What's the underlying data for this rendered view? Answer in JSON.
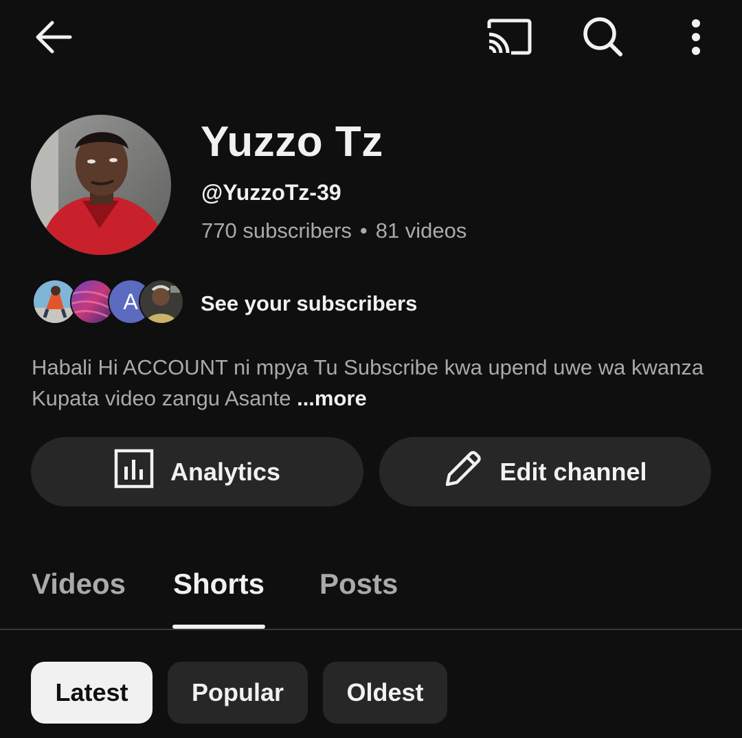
{
  "topbar": {
    "back_icon": "arrow-left-icon",
    "cast_icon": "cast-icon",
    "search_icon": "search-icon",
    "more_icon": "more-vertical-icon"
  },
  "channel": {
    "name": "Yuzzo Tz",
    "handle": "@YuzzoTz-39",
    "subscribers": "770 subscribers",
    "separator": "•",
    "videos": "81 videos"
  },
  "subscribers_row": {
    "label": "See your subscribers",
    "avatar_letter": "A"
  },
  "description": {
    "text": "Habali Hi ACCOUNT ni mpya Tu Subscribe kwa upend uwe wa kwanza Kupata video zangu Asante ",
    "more_label": "...more"
  },
  "actions": {
    "analytics_label": "Analytics",
    "analytics_icon": "analytics-icon",
    "edit_label": "Edit channel",
    "edit_icon": "pencil-icon"
  },
  "tabs": [
    {
      "label": "Videos",
      "active": false
    },
    {
      "label": "Shorts",
      "active": true
    },
    {
      "label": "Posts",
      "active": false
    }
  ],
  "sort_chips": [
    {
      "label": "Latest",
      "selected": true
    },
    {
      "label": "Popular",
      "selected": false
    },
    {
      "label": "Oldest",
      "selected": false
    }
  ],
  "colors": {
    "background": "#0f0f0f",
    "surface": "#272727",
    "text_primary": "#f1f1f1",
    "text_secondary": "#aaaaaa",
    "chip_selected_bg": "#f1f1f1"
  }
}
